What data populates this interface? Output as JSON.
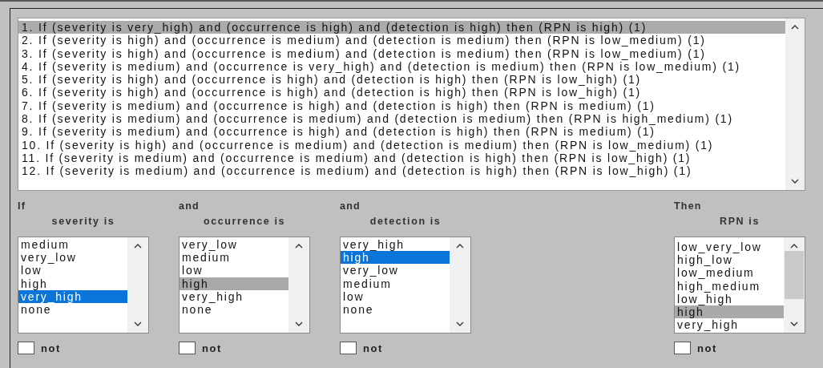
{
  "rules": [
    {
      "text": "1. If (severity is very_high) and (occurrence is high) and (detection is high) then (RPN is high) (1)",
      "selected": true
    },
    {
      "text": "2. If (severity is high) and (occurrence is medium) and (detection is medium) then (RPN is low_medium) (1)",
      "selected": false
    },
    {
      "text": "3. If (severity is high) and (occurrence is medium) and (detection is medium) then (RPN is low_medium) (1)",
      "selected": false
    },
    {
      "text": "4. If (severity is medium) and (occurrence is very_high) and (detection is medium) then (RPN is low_medium) (1)",
      "selected": false
    },
    {
      "text": "5. If (severity is high) and (occurrence is high) and (detection is high) then (RPN is low_high) (1)",
      "selected": false
    },
    {
      "text": "6. If (severity is high) and (occurrence is high) and (detection is high) then (RPN is low_high) (1)",
      "selected": false
    },
    {
      "text": "7. If (severity is medium) and (occurrence is high) and (detection is high) then (RPN is medium) (1)",
      "selected": false
    },
    {
      "text": "8. If (severity is medium) and (occurrence is medium) and (detection is medium) then (RPN is high_medium) (1)",
      "selected": false
    },
    {
      "text": "9. If (severity is medium) and (occurrence is high) and (detection is high) then (RPN is medium) (1)",
      "selected": false
    },
    {
      "text": "10. If (severity is high) and (occurrence is medium) and (detection is medium) then (RPN is low_medium) (1)",
      "selected": false
    },
    {
      "text": "11. If (severity is medium) and (occurrence is medium) and (detection is high) then (RPN is low_high) (1)",
      "selected": false
    },
    {
      "text": "12. If (severity is medium) and (occurrence is medium) and (detection is high) then (RPN is low_high) (1)",
      "selected": false
    }
  ],
  "columns": [
    {
      "connective": "If",
      "variable": "severity is",
      "focused": true,
      "scrollable": false,
      "not_checked": false,
      "not_label": "not",
      "options": [
        {
          "label": "medium",
          "selected": false
        },
        {
          "label": "very_low",
          "selected": false
        },
        {
          "label": "low",
          "selected": false
        },
        {
          "label": "high",
          "selected": false
        },
        {
          "label": "very_high",
          "selected": true
        },
        {
          "label": "none",
          "selected": false
        }
      ]
    },
    {
      "connective": "and",
      "variable": "occurrence is",
      "focused": false,
      "scrollable": false,
      "not_checked": false,
      "not_label": "not",
      "options": [
        {
          "label": "very_low",
          "selected": false
        },
        {
          "label": "medium",
          "selected": false
        },
        {
          "label": "low",
          "selected": false
        },
        {
          "label": "high",
          "selected": true
        },
        {
          "label": "very_high",
          "selected": false
        },
        {
          "label": "none",
          "selected": false
        }
      ]
    },
    {
      "connective": "and",
      "variable": "detection is",
      "focused": true,
      "scrollable": false,
      "not_checked": false,
      "not_label": "not",
      "options": [
        {
          "label": "very_high",
          "selected": false
        },
        {
          "label": "high",
          "selected": true
        },
        {
          "label": "very_low",
          "selected": false
        },
        {
          "label": "medium",
          "selected": false
        },
        {
          "label": "low",
          "selected": false
        },
        {
          "label": "none",
          "selected": false
        }
      ]
    },
    {
      "connective": "Then",
      "variable": "RPN is",
      "focused": false,
      "scrollable": true,
      "not_checked": false,
      "not_label": "not",
      "options": [
        {
          "label": "low_very_low",
          "selected": false
        },
        {
          "label": "high_low",
          "selected": false
        },
        {
          "label": "low_medium",
          "selected": false
        },
        {
          "label": "high_medium",
          "selected": false
        },
        {
          "label": "low_high",
          "selected": false
        },
        {
          "label": "high",
          "selected": true
        },
        {
          "label": "very_high",
          "selected": false
        }
      ]
    }
  ]
}
